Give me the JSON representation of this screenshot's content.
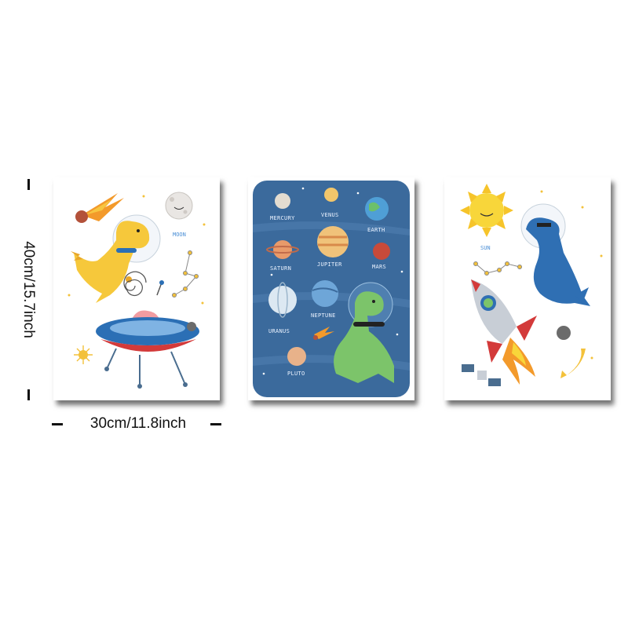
{
  "dimensions": {
    "width_label": "30cm/11.8inch",
    "height_label": "40cm/15.7inch"
  },
  "panels": {
    "left": {
      "moon_label": "MOON"
    },
    "middle": {
      "planet_labels": {
        "mercury": "MERCURY",
        "venus": "VENUS",
        "earth": "EARTH",
        "saturn": "SATURN",
        "jupiter": "JUPITER",
        "mars": "MARS",
        "uranus": "URANUS",
        "neptune": "NEPTUNE",
        "pluto": "PLUTO"
      },
      "background_color": "#3b6a9c"
    },
    "right": {
      "sun_label": "SUN"
    }
  },
  "colors": {
    "frame_shadow": "#000000",
    "planet_panel": "#3b6a9c",
    "label_blue": "#4a8fd6"
  }
}
